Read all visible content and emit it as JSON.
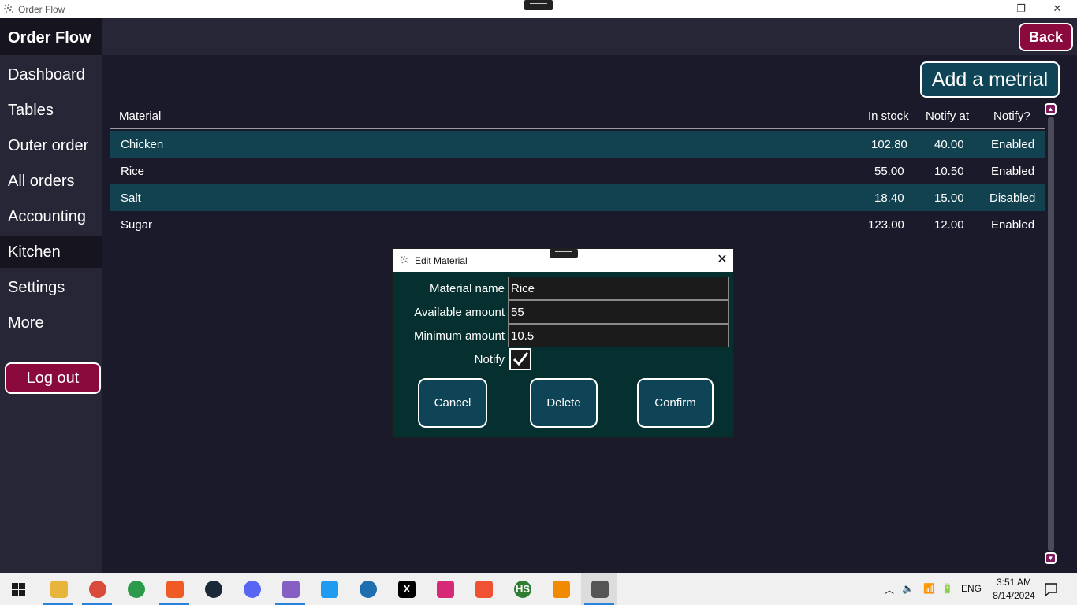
{
  "window": {
    "title": "Order Flow",
    "minimize_glyph": "—",
    "restore_glyph": "❐",
    "close_glyph": "✕"
  },
  "sidebar": {
    "brand": "Order Flow",
    "items": [
      {
        "label": "Dashboard"
      },
      {
        "label": "Tables"
      },
      {
        "label": "Outer order"
      },
      {
        "label": "All orders"
      },
      {
        "label": "Accounting"
      },
      {
        "label": "Kitchen",
        "active": true
      },
      {
        "label": "Settings"
      },
      {
        "label": "More"
      }
    ],
    "logout_label": "Log out"
  },
  "header": {
    "back_label": "Back"
  },
  "main": {
    "add_button_label": "Add a metrial",
    "columns": [
      "Material",
      "In stock",
      "Notify at",
      "Notify?"
    ],
    "rows": [
      {
        "material": "Chicken",
        "in_stock": "102.80",
        "notify_at": "40.00",
        "notify": "Enabled"
      },
      {
        "material": "Rice",
        "in_stock": "55.00",
        "notify_at": "10.50",
        "notify": "Enabled"
      },
      {
        "material": "Salt",
        "in_stock": "18.40",
        "notify_at": "15.00",
        "notify": "Disabled"
      },
      {
        "material": "Sugar",
        "in_stock": "123.00",
        "notify_at": "12.00",
        "notify": "Enabled"
      }
    ]
  },
  "dialog": {
    "title": "Edit Material",
    "close_glyph": "✕",
    "fields": {
      "material_name_label": "Material name",
      "material_name_value": "Rice",
      "available_label": "Available amount",
      "available_value": "55",
      "minimum_label": "Minimum amount",
      "minimum_value": "10.5",
      "notify_label": "Notify",
      "notify_checked": true
    },
    "buttons": {
      "cancel": "Cancel",
      "delete": "Delete",
      "confirm": "Confirm"
    }
  },
  "taskbar": {
    "language": "ENG",
    "time": "3:51 AM",
    "date": "8/14/2024",
    "apps": [
      {
        "icon": "file-explorer-icon",
        "color": "#e8b53c"
      },
      {
        "icon": "chrome-icon",
        "color": "#d94a3a"
      },
      {
        "icon": "chrome-icon",
        "color": "#2b9b4b"
      },
      {
        "icon": "brave-icon",
        "color": "#f05a24"
      },
      {
        "icon": "steam-icon",
        "color": "#1b2838"
      },
      {
        "icon": "discord-icon",
        "color": "#5865f2"
      },
      {
        "icon": "visual-studio-icon",
        "color": "#865fc5"
      },
      {
        "icon": "vscode-icon",
        "color": "#1f9cf0"
      },
      {
        "icon": "vivaldi-icon",
        "color": "#1f6fb0"
      },
      {
        "icon": "x-icon",
        "color": "#000000"
      },
      {
        "icon": "instagram-icon",
        "color": "#d62976"
      },
      {
        "icon": "git-icon",
        "color": "#f05133"
      },
      {
        "icon": "hs-icon",
        "color": "#2e7d32"
      },
      {
        "icon": "vlc-icon",
        "color": "#f08a00"
      },
      {
        "icon": "order-flow-icon",
        "color": "#555555"
      }
    ],
    "app_labels": [
      "",
      "",
      "",
      "",
      "",
      "",
      "",
      "",
      "",
      "X",
      "",
      "",
      "HS",
      "",
      ""
    ]
  },
  "colors": {
    "background": "#1b1a2b",
    "sidebar": "#262637",
    "accent_red": "#8b0a3d",
    "accent_teal": "#0f4457",
    "row_highlight": "#12414f",
    "dialog_bg": "#06302f"
  }
}
